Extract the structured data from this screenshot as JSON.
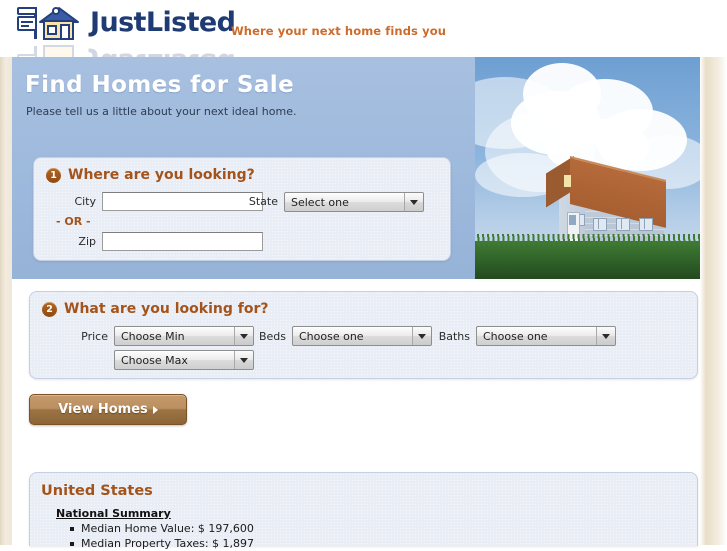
{
  "brand": {
    "logo_text": "JustListed",
    "logo_icon": "house-with-sign-icon",
    "tagline": "Where your next home finds you",
    "logo_color": "#1f3b73",
    "tagline_color": "#cc6b2c"
  },
  "banner": {
    "title": "Find Homes for Sale",
    "subtitle": "Please tell us a little about your next ideal home.",
    "background_color": "#9cb8dc",
    "photo_alt": "house-on-grass-photo"
  },
  "step1": {
    "number": "1",
    "heading": "Where are you looking?",
    "city_label": "City",
    "city_value": "",
    "city_placeholder": "",
    "or_label": "- OR -",
    "zip_label": "Zip",
    "zip_value": "",
    "zip_placeholder": "",
    "state_label": "State",
    "state_value": "Select one"
  },
  "step2": {
    "number": "2",
    "heading": "What are you looking for?",
    "price_label": "Price",
    "price_min_value": "Choose Min",
    "price_max_value": "Choose Max",
    "beds_label": "Beds",
    "beds_value": "Choose one",
    "baths_label": "Baths",
    "baths_value": "Choose one"
  },
  "actions": {
    "view_homes_label": "View Homes",
    "view_homes_arrow": "play-triangle-icon",
    "button_color": "#9a7243"
  },
  "stats": {
    "region_title": "United States",
    "section_title": "National Summary",
    "items": [
      "Median Home Value: $ 197,600",
      "Median Property Taxes: $ 1,897"
    ]
  },
  "theme": {
    "accent_brown": "#a4541b",
    "panel_bg": "#e8edf6",
    "gutter_color": "#efe7d8"
  }
}
